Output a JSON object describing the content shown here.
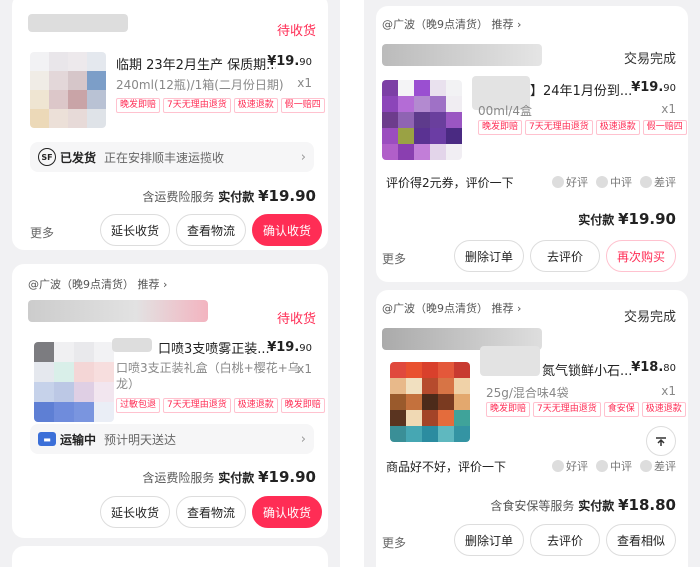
{
  "colors": {
    "accent": "#ff2d55",
    "background": "#f1f1f3"
  },
  "left_orders": [
    {
      "status": "待收货",
      "product_title": "临期 23年2月生产  保质期...",
      "price": "¥19.",
      "price_cents": "90",
      "spec": "240ml(12瓶)/1箱(二月份日期)",
      "qty": "x1",
      "tags": [
        "晚发即赔",
        "7天无理由退货",
        "极速退款",
        "假一赔四"
      ],
      "banner": {
        "icon": "SF",
        "status": "已发货",
        "text": "正在安排顺丰速运揽收",
        "chevron": "›"
      },
      "pay_prefix": "含运费险服务",
      "pay_label": "实付款",
      "pay_amount": "¥19.90",
      "more": "更多",
      "buttons": [
        "延长收货",
        "查看物流",
        "确认收货"
      ]
    },
    {
      "shop": "@广波（晚9点清货） 推荐 ›",
      "status": "待收货",
      "product_title": "口喷3支喷雾正装...",
      "price": "¥19.",
      "price_cents": "90",
      "spec": "口喷3支正装礼盒（白桃+樱花+乌龙）",
      "qty": "x1",
      "tags": [
        "过敏包退",
        "7天无理由退货",
        "极速退款",
        "晚发即赔"
      ],
      "banner": {
        "icon": "truck",
        "status": "运输中",
        "text": "预计明天送达",
        "chevron": "›"
      },
      "pay_prefix": "含运费险服务",
      "pay_label": "实付款",
      "pay_amount": "¥19.90",
      "buttons": [
        "延长收货",
        "查看物流",
        "确认收货"
      ]
    }
  ],
  "right_orders": [
    {
      "shop": "@广波（晚9点清货） 推荐 ›",
      "status": "交易完成",
      "product_title": "】24年1月份到...",
      "price": "¥19.",
      "price_cents": "90",
      "spec": "00ml/4盒",
      "qty": "x1",
      "tags": [
        "晚发即赔",
        "7天无理由退货",
        "极速退款",
        "假一赔四"
      ],
      "review_prompt": "评价得2元券，评价一下",
      "ratings": [
        "好评",
        "中评",
        "差评"
      ],
      "pay_label": "实付款",
      "pay_amount": "¥19.90",
      "more": "更多",
      "buttons": [
        "删除订单",
        "去评价",
        "再次购买"
      ]
    },
    {
      "shop": "@广波（晚9点清货） 推荐 ›",
      "status": "交易完成",
      "product_title": "氮气锁鲜小石...",
      "price": "¥18.",
      "price_cents": "80",
      "spec": "25g/混合味4袋",
      "qty": "x1",
      "tags": [
        "晚发即赔",
        "7天无理由退货",
        "食安保",
        "极速退款"
      ],
      "review_prompt": "商品好不好，评价一下",
      "ratings": [
        "好评",
        "中评",
        "差评"
      ],
      "pay_prefix": "含食安保等服务",
      "pay_label": "实付款",
      "pay_amount": "¥18.80",
      "more": "更多",
      "buttons": [
        "删除订单",
        "去评价",
        "查看相似"
      ]
    }
  ],
  "scroll_top_icon": "scroll-to-top-icon"
}
